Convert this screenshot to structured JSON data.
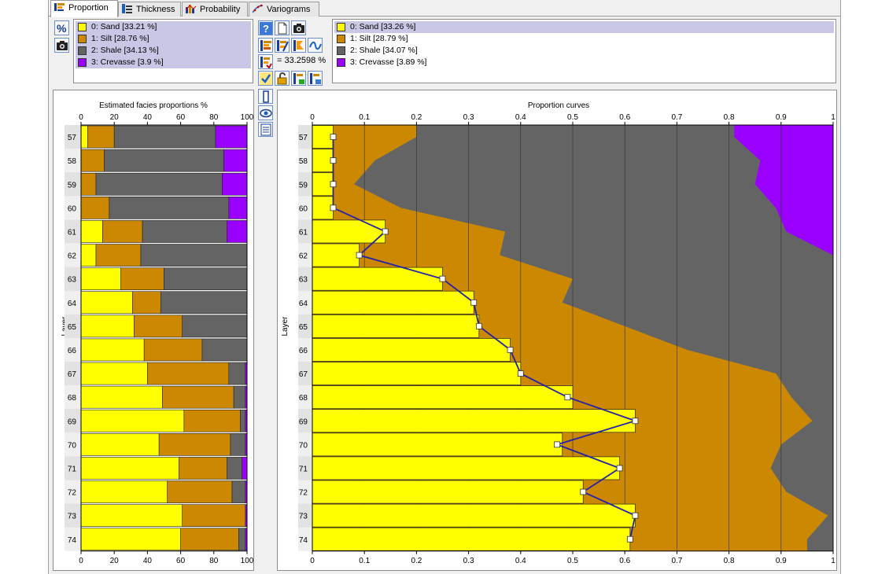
{
  "tabs": [
    {
      "label": "Proportion",
      "active": true
    },
    {
      "label": "Thickness",
      "active": false
    },
    {
      "label": "Probability",
      "active": false
    },
    {
      "label": "Variograms",
      "active": false
    }
  ],
  "colors": {
    "sand": "#ffff00",
    "silt": "#cc8800",
    "shale": "#646464",
    "crevasse": "#9900ff",
    "curve": "#2222aa"
  },
  "left_legend": [
    {
      "label": "0: Sand [33.21 %]",
      "color": "#ffff00"
    },
    {
      "label": "1: Silt [28.76 %]",
      "color": "#cc8800"
    },
    {
      "label": "2: Shale [34.13 %]",
      "color": "#646464"
    },
    {
      "label": "3: Crevasse [3.9 %]",
      "color": "#9900ff"
    }
  ],
  "right_legend": [
    {
      "label": "0: Sand [33.26 %]",
      "color": "#ffff00"
    },
    {
      "label": "1: Silt [28.79 %]",
      "color": "#cc8800"
    },
    {
      "label": "2: Shale [34.07 %]",
      "color": "#646464"
    },
    {
      "label": "3: Crevasse [3.89 %]",
      "color": "#9900ff"
    }
  ],
  "toolbar": {
    "value_prefix": "=",
    "value": "33.2598",
    "unit": "%",
    "icons": [
      "percent-icon",
      "camera-icon",
      "help-icon",
      "new-page-icon",
      "camera-icon",
      "bar-chart-icon",
      "bar-chart-edit-icon",
      "curve-chart-icon",
      "wave-icon",
      "chart-apply-icon",
      "check-icon",
      "unlock-icon",
      "chart-lock-icon",
      "chart-unlock-icon",
      "vertical-bar-icon",
      "eye-icon",
      "list-icon"
    ]
  },
  "chart_data": [
    {
      "type": "bar",
      "orientation": "horizontal-stacked",
      "title": "Estimated facies proportions %",
      "ylabel": "Layer",
      "xlim": [
        0,
        100
      ],
      "xticks": [
        0,
        20,
        40,
        60,
        80,
        100
      ],
      "categories": [
        "57",
        "58",
        "59",
        "60",
        "61",
        "62",
        "63",
        "64",
        "65",
        "66",
        "67",
        "68",
        "69",
        "70",
        "71",
        "72",
        "73",
        "74"
      ],
      "series": [
        {
          "name": "0: Sand",
          "values": [
            4,
            0,
            0,
            0,
            13,
            9,
            24,
            31,
            32,
            38,
            40,
            49,
            62,
            47,
            59,
            52,
            61,
            60
          ]
        },
        {
          "name": "1: Silt",
          "values": [
            16,
            14,
            9,
            17,
            24,
            27,
            26,
            17,
            29,
            35,
            49,
            43,
            34,
            43,
            29,
            39,
            38,
            35
          ]
        },
        {
          "name": "2: Shale",
          "values": [
            61,
            72,
            76,
            72,
            51,
            64,
            50,
            52,
            39,
            27,
            10,
            7,
            3,
            9,
            9,
            8,
            0,
            4
          ]
        },
        {
          "name": "3: Crevasse",
          "values": [
            19,
            14,
            15,
            11,
            12,
            0,
            0,
            0,
            0,
            0,
            1,
            1,
            1,
            1,
            3,
            1,
            1,
            1
          ]
        }
      ]
    },
    {
      "type": "area",
      "title": "Proportion curves",
      "ylabel": "Layer",
      "xlim": [
        0,
        1
      ],
      "xticks": [
        "0",
        "0.1",
        "0.2",
        "0.3",
        "0.4",
        "0.5",
        "0.6",
        "0.7",
        "0.8",
        "0.9",
        "1"
      ],
      "categories": [
        "57",
        "58",
        "59",
        "60",
        "61",
        "62",
        "63",
        "64",
        "65",
        "66",
        "67",
        "68",
        "69",
        "70",
        "71",
        "72",
        "73",
        "74"
      ],
      "bars": [
        0.04,
        0.04,
        0.04,
        0.04,
        0.14,
        0.09,
        0.25,
        0.31,
        0.32,
        0.38,
        0.4,
        0.5,
        0.62,
        0.48,
        0.59,
        0.52,
        0.62,
        0.61
      ],
      "curve": [
        0.04,
        0.04,
        0.04,
        0.04,
        0.14,
        0.09,
        0.25,
        0.31,
        0.32,
        0.38,
        0.4,
        0.49,
        0.62,
        0.47,
        0.59,
        0.52,
        0.62,
        0.61
      ],
      "cumulative_sand_silt": [
        0.2,
        0.12,
        0.08,
        0.17,
        0.37,
        0.36,
        0.5,
        0.48,
        0.6,
        0.72,
        0.89,
        0.92,
        0.96,
        0.9,
        0.88,
        0.91,
        0.99,
        0.95
      ],
      "cumulative_sand_silt_shale": [
        0.81,
        0.86,
        0.85,
        0.89,
        0.91,
        1.0,
        1.0,
        1.0,
        1.0,
        1.0,
        1.0,
        1.0,
        1.0,
        1.0,
        1.0,
        1.0,
        1.0,
        1.0
      ]
    }
  ]
}
